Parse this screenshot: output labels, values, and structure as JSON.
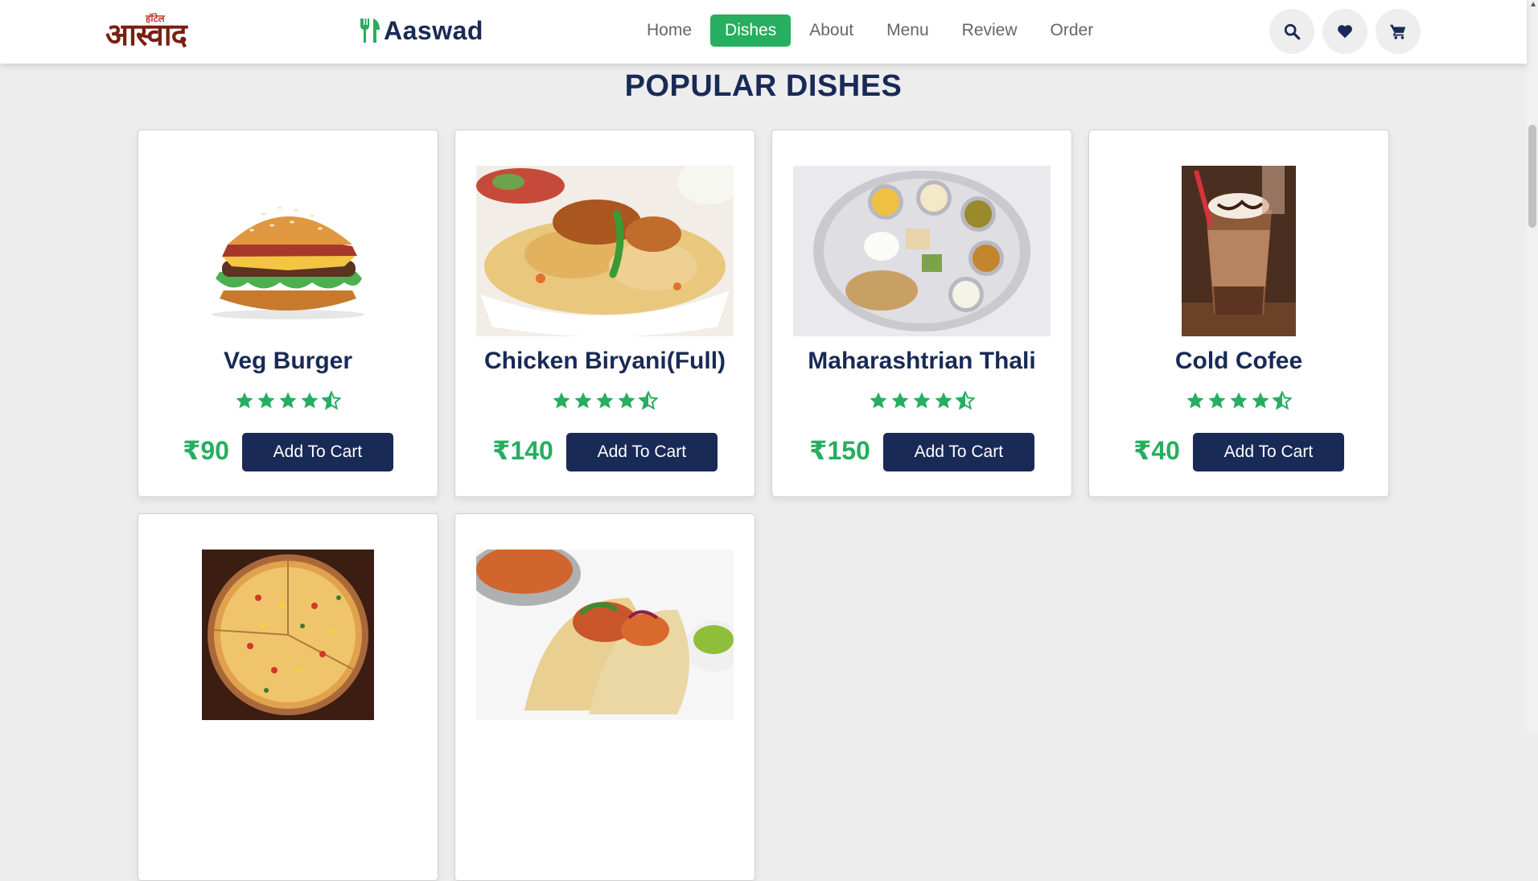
{
  "header": {
    "logo_small": "हॉटेल",
    "logo_big": "आस्वाद",
    "brand_name": "Aaswad",
    "nav": [
      {
        "label": "Home",
        "active": false
      },
      {
        "label": "Dishes",
        "active": true
      },
      {
        "label": "About",
        "active": false
      },
      {
        "label": "Menu",
        "active": false
      },
      {
        "label": "Review",
        "active": false
      },
      {
        "label": "Order",
        "active": false
      }
    ],
    "icons": [
      "search-icon",
      "heart-icon",
      "cart-icon"
    ]
  },
  "section": {
    "title": "POPULAR DISHES"
  },
  "dishes": [
    {
      "name": "Veg Burger",
      "rating": 4.5,
      "price": "₹90",
      "button": "Add To Cart",
      "image": "burger"
    },
    {
      "name": "Chicken Biryani(Full)",
      "rating": 4.5,
      "price": "₹140",
      "button": "Add To Cart",
      "image": "biryani"
    },
    {
      "name": "Maharashtrian Thali",
      "rating": 4.5,
      "price": "₹150",
      "button": "Add To Cart",
      "image": "thali"
    },
    {
      "name": "Cold Cofee",
      "rating": 4.5,
      "price": "₹40",
      "button": "Add To Cart",
      "image": "coffee"
    },
    {
      "name": "",
      "rating": null,
      "price": "",
      "button": "",
      "image": "pizza"
    },
    {
      "name": "",
      "rating": null,
      "price": "",
      "button": "",
      "image": "wrap"
    }
  ],
  "colors": {
    "navy": "#192a56",
    "green": "#27ae60",
    "background": "#ededed"
  }
}
